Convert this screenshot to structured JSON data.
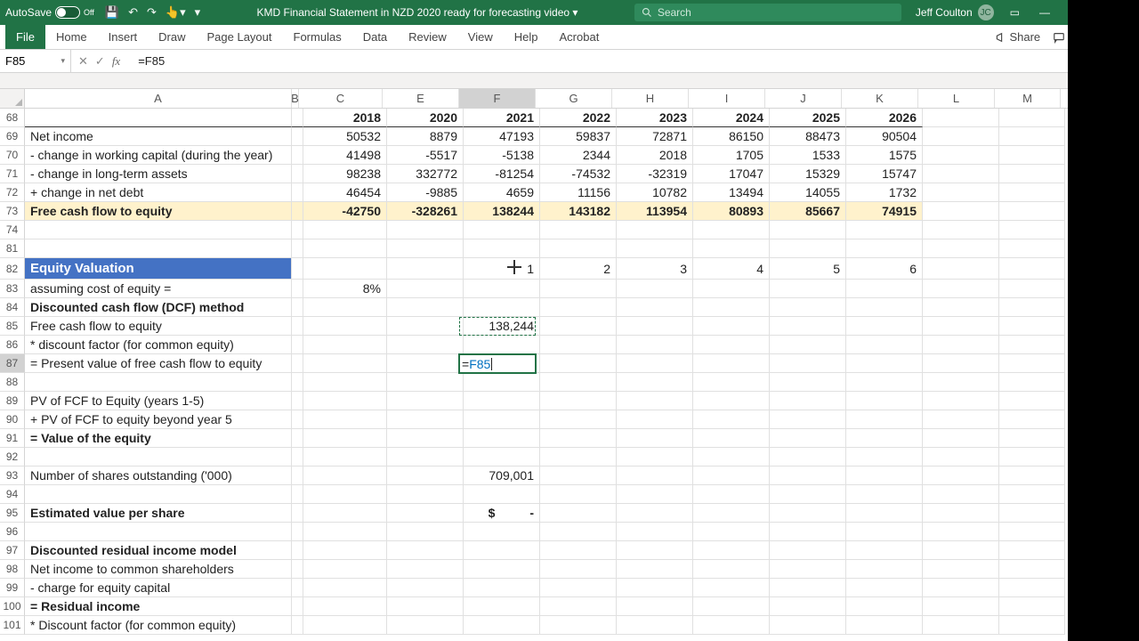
{
  "titlebar": {
    "autosave_label": "AutoSave",
    "autosave_state": "Off",
    "doc_title": "KMD Financial Statement in NZD 2020 ready for forecasting video ▾",
    "search_placeholder": "Search",
    "user_name": "Jeff Coulton",
    "user_initials": "JC"
  },
  "ribbon": {
    "tabs": [
      "File",
      "Home",
      "Insert",
      "Draw",
      "Page Layout",
      "Formulas",
      "Data",
      "Review",
      "View",
      "Help",
      "Acrobat"
    ],
    "share": "Share",
    "comments": "Comments"
  },
  "formula_bar": {
    "name_box": "F85",
    "formula": "=F85"
  },
  "columns": [
    "A",
    "B",
    "C",
    "E",
    "F",
    "G",
    "H",
    "I",
    "J",
    "K",
    "L",
    "M"
  ],
  "selected_col": "F",
  "row_numbers": [
    68,
    69,
    70,
    71,
    72,
    73,
    74,
    81,
    82,
    83,
    84,
    85,
    86,
    87,
    88,
    89,
    90,
    91,
    92,
    93,
    94,
    95,
    96,
    97,
    98,
    99,
    100,
    101
  ],
  "selected_row": 87,
  "years_row": {
    "C": "2018",
    "E": "2020",
    "F": "2021",
    "G": "2022",
    "H": "2023",
    "I": "2024",
    "J": "2025",
    "K": "2026"
  },
  "data_rows": {
    "net_income": {
      "label": "Net income",
      "C": "50532",
      "E": "8879",
      "F": "47193",
      "G": "59837",
      "H": "72871",
      "I": "86150",
      "J": "88473",
      "K": "90504"
    },
    "chg_wc": {
      "label": "- change in working capital (during the year)",
      "C": "41498",
      "E": "-5517",
      "F": "-5138",
      "G": "2344",
      "H": "2018",
      "I": "1705",
      "J": "1533",
      "K": "1575"
    },
    "chg_lta": {
      "label": "- change in long-term assets",
      "C": "98238",
      "E": "332772",
      "F": "-81254",
      "G": "-74532",
      "H": "-32319",
      "I": "17047",
      "J": "15329",
      "K": "15747"
    },
    "chg_netdebt": {
      "label": "+ change in net debt",
      "C": "46454",
      "E": "-9885",
      "F": "4659",
      "G": "11156",
      "H": "10782",
      "I": "13494",
      "J": "14055",
      "K": "1732"
    },
    "fcfe": {
      "label": "Free cash flow to equity",
      "C": "-42750",
      "E": "-328261",
      "F": "138244",
      "G": "143182",
      "H": "113954",
      "I": "80893",
      "J": "85667",
      "K": "74915"
    }
  },
  "valuation": {
    "section_title": "Equity Valuation",
    "periods": {
      "F": "1",
      "G": "2",
      "H": "3",
      "I": "4",
      "J": "5",
      "K": "6"
    },
    "cost_label": "assuming cost of equity =",
    "cost_value": "8%",
    "dcf_header": "Discounted cash flow (DCF) method",
    "fcfe_label": "Free cash flow to equity",
    "fcfe_value": "138,244",
    "df_label": "* discount factor (for common equity)",
    "pv_label": "= Present value of free cash flow to equity",
    "editing_formula_prefix": "=",
    "editing_formula_ref": "F85",
    "pv15_label": "   PV of FCF to Equity (years 1-5)",
    "pvb5_label": "+ PV of FCF to equity beyond year 5",
    "value_eq_label": "= Value of the equity",
    "shares_label": "Number of shares outstanding ('000)",
    "shares_value": "709,001",
    "est_label": "Estimated value per share",
    "est_value": "$          -",
    "dri_header": "Discounted residual income model",
    "ni_common": "Net income to common shareholders",
    "charge": "- charge for equity capital",
    "ri": "= Residual income",
    "df2": "* Discount factor (for common equity)"
  }
}
